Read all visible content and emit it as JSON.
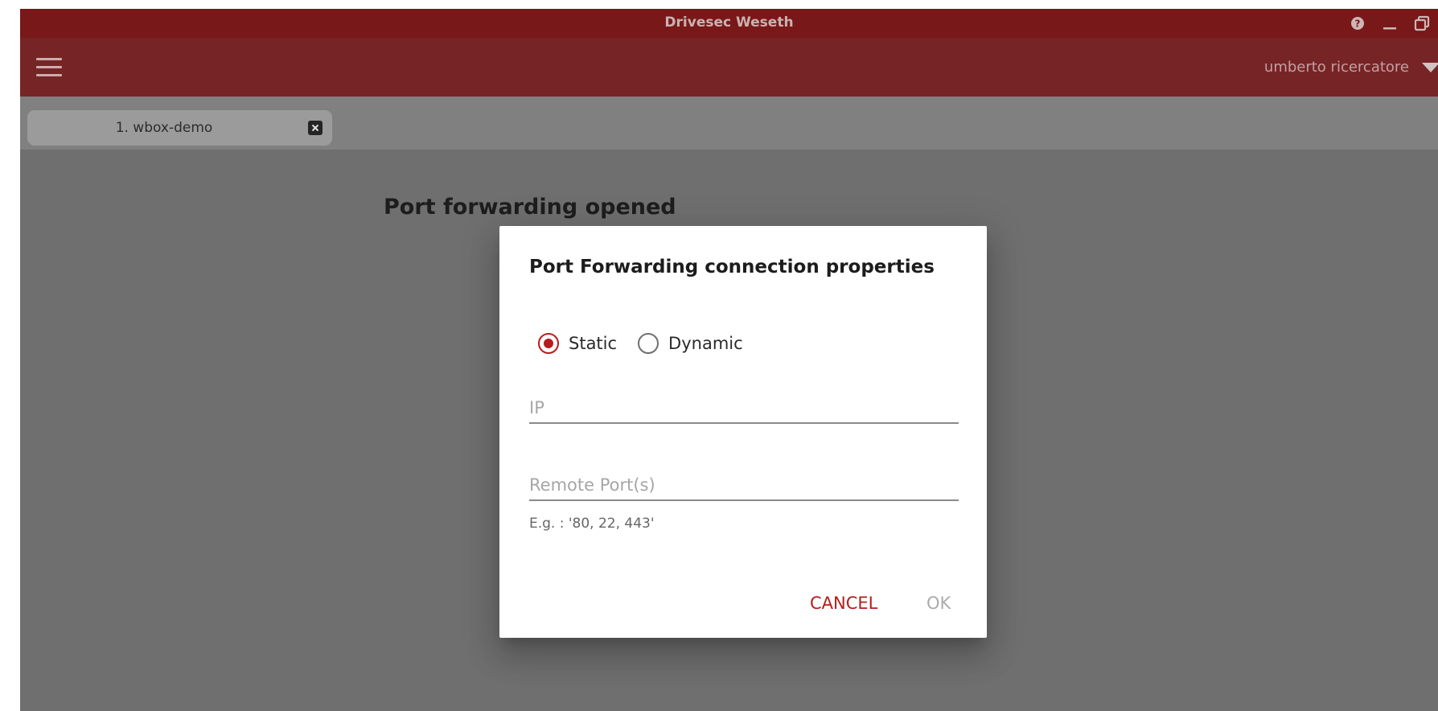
{
  "window": {
    "title": "Drivesec Weseth",
    "controls": [
      "help-icon",
      "minimize-icon",
      "restore-icon"
    ]
  },
  "appbar": {
    "menu_icon": "hamburger-menu-icon",
    "user_name": "umberto ricercatore",
    "user_menu_icon": "caret-down-icon"
  },
  "tabs": [
    {
      "label": "1. wbox-demo",
      "close_icon": "close-icon"
    }
  ],
  "page": {
    "heading": "Port forwarding opened"
  },
  "dialog": {
    "title": "Port Forwarding connection properties",
    "mode_options": [
      {
        "label": "Static",
        "checked": true
      },
      {
        "label": "Dynamic",
        "checked": false
      }
    ],
    "ip_field": {
      "value": "",
      "placeholder": "IP"
    },
    "port_field": {
      "value": "",
      "placeholder": "Remote Port(s)"
    },
    "port_hint": "E.g. : '80, 22, 443'",
    "cancel_label": "CANCEL",
    "ok_label": "OK"
  },
  "colors": {
    "title_bar": "#8c1c1c",
    "app_bar": "#892a2c",
    "accent": "#b71c1c",
    "disabled_text": "#ababab"
  }
}
